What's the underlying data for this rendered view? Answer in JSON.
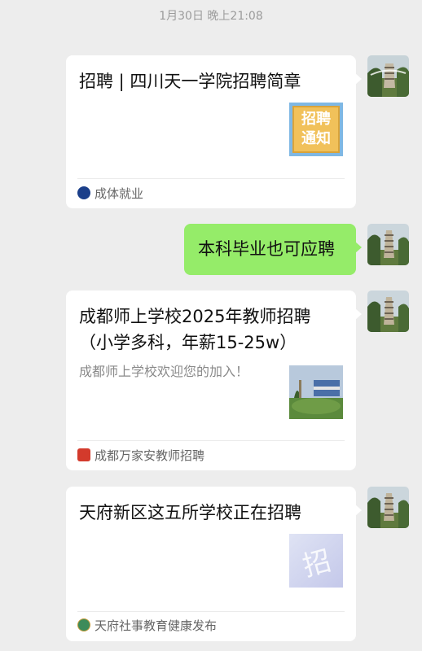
{
  "timestamp": "1月30日 晚上21:08",
  "messages": [
    {
      "type": "article",
      "title": "招聘 | 四川天一学院招聘简章",
      "thumb_text": [
        "招聘",
        "通知"
      ],
      "source": "成体就业",
      "source_icon_text": "成体就业"
    },
    {
      "type": "text",
      "text": "本科毕业也可应聘"
    },
    {
      "type": "article",
      "title_lines": [
        "成都师上学校2025年教师招聘",
        "（小学多科，年薪15-25w）"
      ],
      "desc": "成都师上学校欢迎您的加入！",
      "source": "成都万家安教师招聘",
      "source_icon_text": "招聘"
    },
    {
      "type": "article",
      "title": "天府新区这五所学校正在招聘",
      "thumb_text": "招",
      "source": "天府社事教育健康发布"
    }
  ],
  "colors": {
    "background": "#ededed",
    "bubble_self": "#95ec69",
    "card": "#ffffff"
  }
}
